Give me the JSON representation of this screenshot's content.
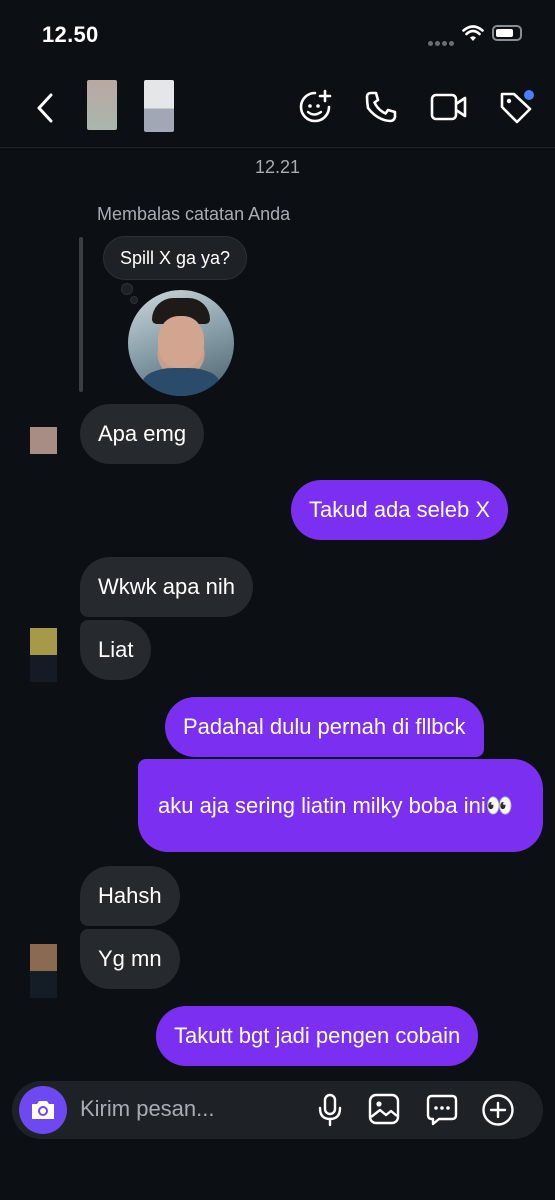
{
  "status_bar": {
    "time": "12.50"
  },
  "header": {
    "back_icon": "chevron-left-icon",
    "actions": [
      "effects-icon",
      "phone-icon",
      "video-icon",
      "tag-icon"
    ],
    "accent": "#4e7cff"
  },
  "thread": {
    "timestamp": "12.21",
    "reply_context": "Membalas catatan Anda",
    "note_text": "Spill X ga ya?",
    "messages": [
      {
        "side": "in",
        "text": "Apa emg"
      },
      {
        "side": "out",
        "text": "Takud ada seleb X"
      },
      {
        "side": "in",
        "text": "Wkwk apa nih"
      },
      {
        "side": "in",
        "text": "Liat"
      },
      {
        "side": "out",
        "text": "Padahal dulu pernah di fllbck"
      },
      {
        "side": "out",
        "text": "aku aja sering liatin milky boba ini👀"
      },
      {
        "side": "in",
        "text": "Hahsh"
      },
      {
        "side": "in",
        "text": "Yg mn"
      },
      {
        "side": "out",
        "text": "Takutt bgt jadi pengen cobain"
      }
    ]
  },
  "composer": {
    "placeholder": "Kirim pesan...",
    "icons": [
      "camera-icon",
      "microphone-icon",
      "image-icon",
      "sticker-icon",
      "plus-icon"
    ]
  },
  "colors": {
    "outgoing": "#7b2ff0",
    "incoming": "#262a2f",
    "background": "#0c1014",
    "camera": "#6e48f0"
  }
}
